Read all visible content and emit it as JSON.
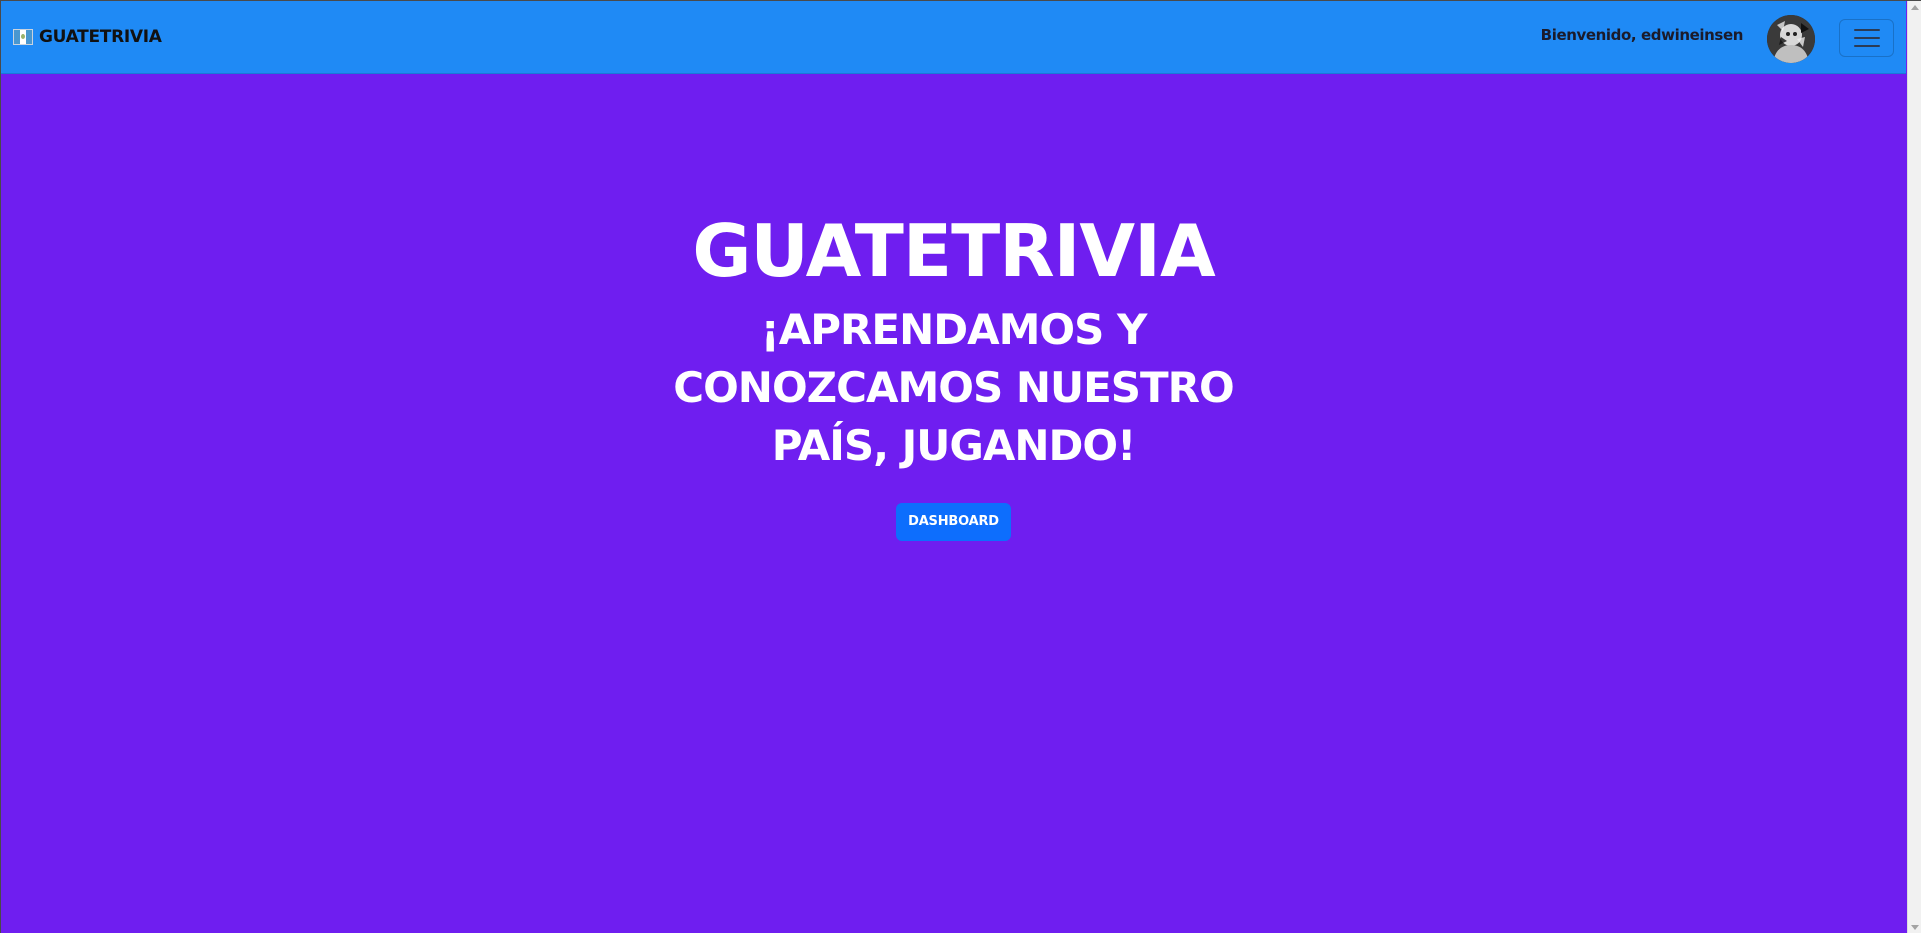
{
  "navbar": {
    "brand_name": "GuateTrivia",
    "welcome_text": "Bienvenido, edwineinsen",
    "icons": {
      "flag": "guatemala-flag-icon",
      "menu": "hamburger-menu-icon"
    }
  },
  "hero": {
    "title": "GuateTrivia",
    "subtitle": "¡Aprendamos y conozcamos nuestro país, jugando!",
    "button_label": "Dashboard"
  },
  "colors": {
    "navbar_bg": "#1f8af5",
    "page_bg": "#6f1ef0",
    "button_bg": "#0d6efd",
    "text_light": "#ffffff"
  }
}
